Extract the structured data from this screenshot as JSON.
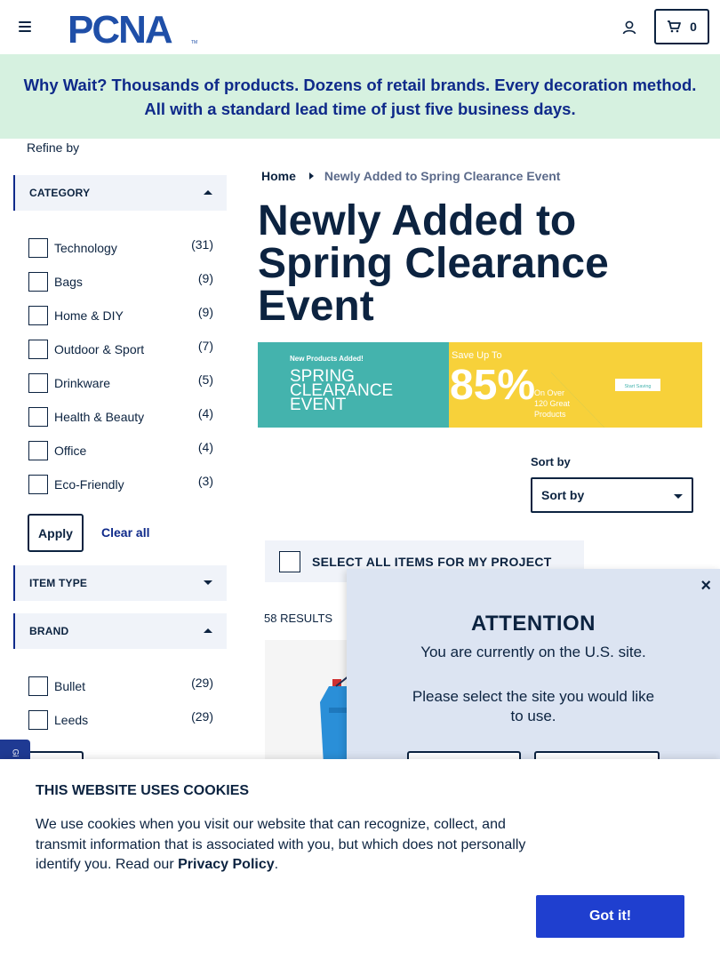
{
  "header": {
    "logo_text": "PCNA",
    "logo_tm": "TM",
    "cart_count": "0"
  },
  "promo": {
    "text": "Why Wait? Thousands of products. Dozens of retail brands. Every decoration method. All with a standard lead time of just five business days."
  },
  "sidebar": {
    "refine_label": "Refine by",
    "category": {
      "title": "CATEGORY",
      "items": [
        {
          "label": "Technology",
          "count": "(31)"
        },
        {
          "label": "Bags",
          "count": "(9)"
        },
        {
          "label": "Home & DIY",
          "count": "(9)"
        },
        {
          "label": "Outdoor & Sport",
          "count": "(7)"
        },
        {
          "label": "Drinkware",
          "count": "(5)"
        },
        {
          "label": "Health & Beauty",
          "count": "(4)"
        },
        {
          "label": "Office",
          "count": "(4)"
        },
        {
          "label": "Eco-Friendly",
          "count": "(3)"
        }
      ]
    },
    "apply_label": "Apply",
    "clear_label": "Clear all",
    "item_type": {
      "title": "ITEM TYPE"
    },
    "brand": {
      "title": "BRAND",
      "items": [
        {
          "label": "Bullet",
          "count": "(29)"
        },
        {
          "label": "Leeds",
          "count": "(29)"
        }
      ]
    },
    "side_tab_text": "Gi"
  },
  "breadcrumb": {
    "home": "Home",
    "current": "Newly Added to Spring Clearance Event"
  },
  "page_title": "Newly Added to Spring Clearance Event",
  "hero": {
    "small_text": "New Products Added!",
    "event_line1": "SPRING",
    "event_line2": "CLEARANCE",
    "event_line3": "EVENT",
    "save_up_to": "Save Up To",
    "percent": "85%",
    "on_over": "On Over",
    "products": "120 Great",
    "products2": "Products",
    "cta": "Start Saving"
  },
  "sort": {
    "label": "Sort by",
    "selected": "Sort by"
  },
  "select_all_label": "SELECT ALL ITEMS FOR MY PROJECT",
  "results_label": "58 RESULTS",
  "modal": {
    "close": "×",
    "title": "ATTENTION",
    "line1": "You are currently on the U.S. site.",
    "line2": "Please select the site you would like to use."
  },
  "cookie": {
    "title": "THIS WEBSITE USES COOKIES",
    "text": "We use cookies when you visit our website that can recognize, collect, and transmit information that is associated with you, but which does not personally identify you. Read our",
    "link": "Privacy Policy",
    "period": ".",
    "button": "Got it!"
  },
  "colors": {
    "navy": "#0c2340",
    "brand_blue": "#0f2a8a",
    "promo_bg": "#d6f1e0",
    "cta_blue": "#1f3fcf",
    "hero_teal": "#44b3ad",
    "hero_yellow": "#f7d13a"
  }
}
